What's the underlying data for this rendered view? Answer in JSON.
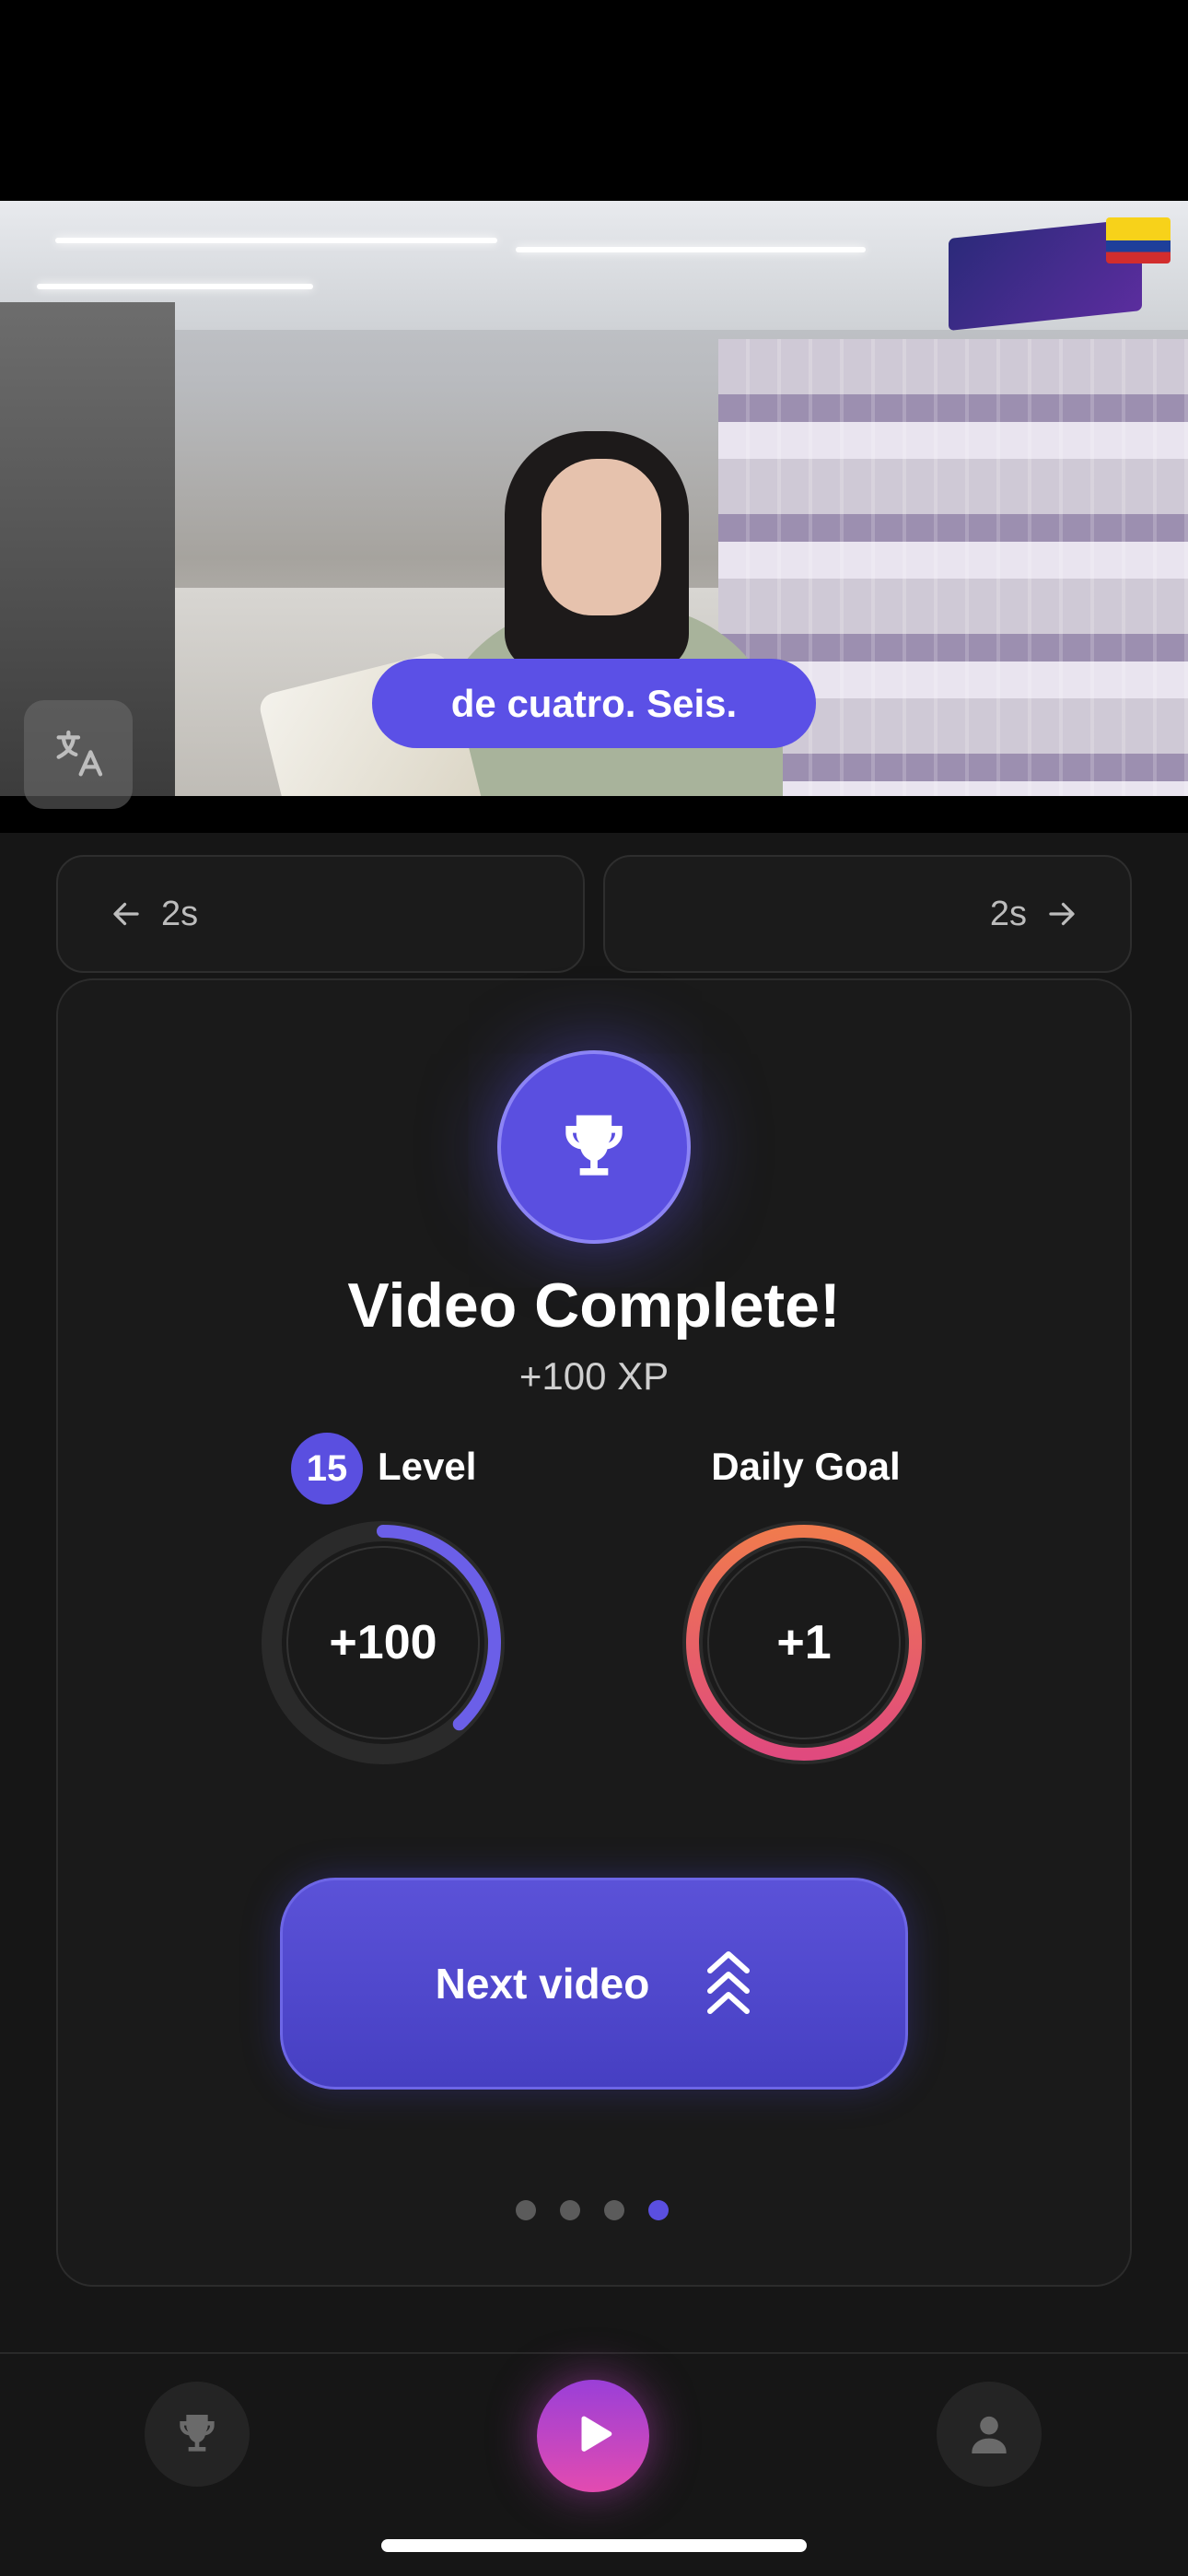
{
  "video": {
    "subtitle": "de cuatro. Seis.",
    "translate_icon": "translate-icon",
    "language_flag": "colombia-flag"
  },
  "seek": {
    "back_label": "2s",
    "forward_label": "2s"
  },
  "completion": {
    "title": "Video Complete!",
    "xp": "+100 XP",
    "level_number": "15",
    "level_label": "Level",
    "level_value": "+100",
    "level_progress": 0.38,
    "goal_label": "Daily Goal",
    "goal_value": "+1",
    "goal_progress": 1.0,
    "next_button_label": "Next video"
  },
  "pager": {
    "count": 4,
    "active_index": 3
  },
  "colors": {
    "accent": "#5a4fe0",
    "goal_gradient_start": "#e04a7e",
    "goal_gradient_end": "#f07a4e",
    "background": "#161616"
  }
}
